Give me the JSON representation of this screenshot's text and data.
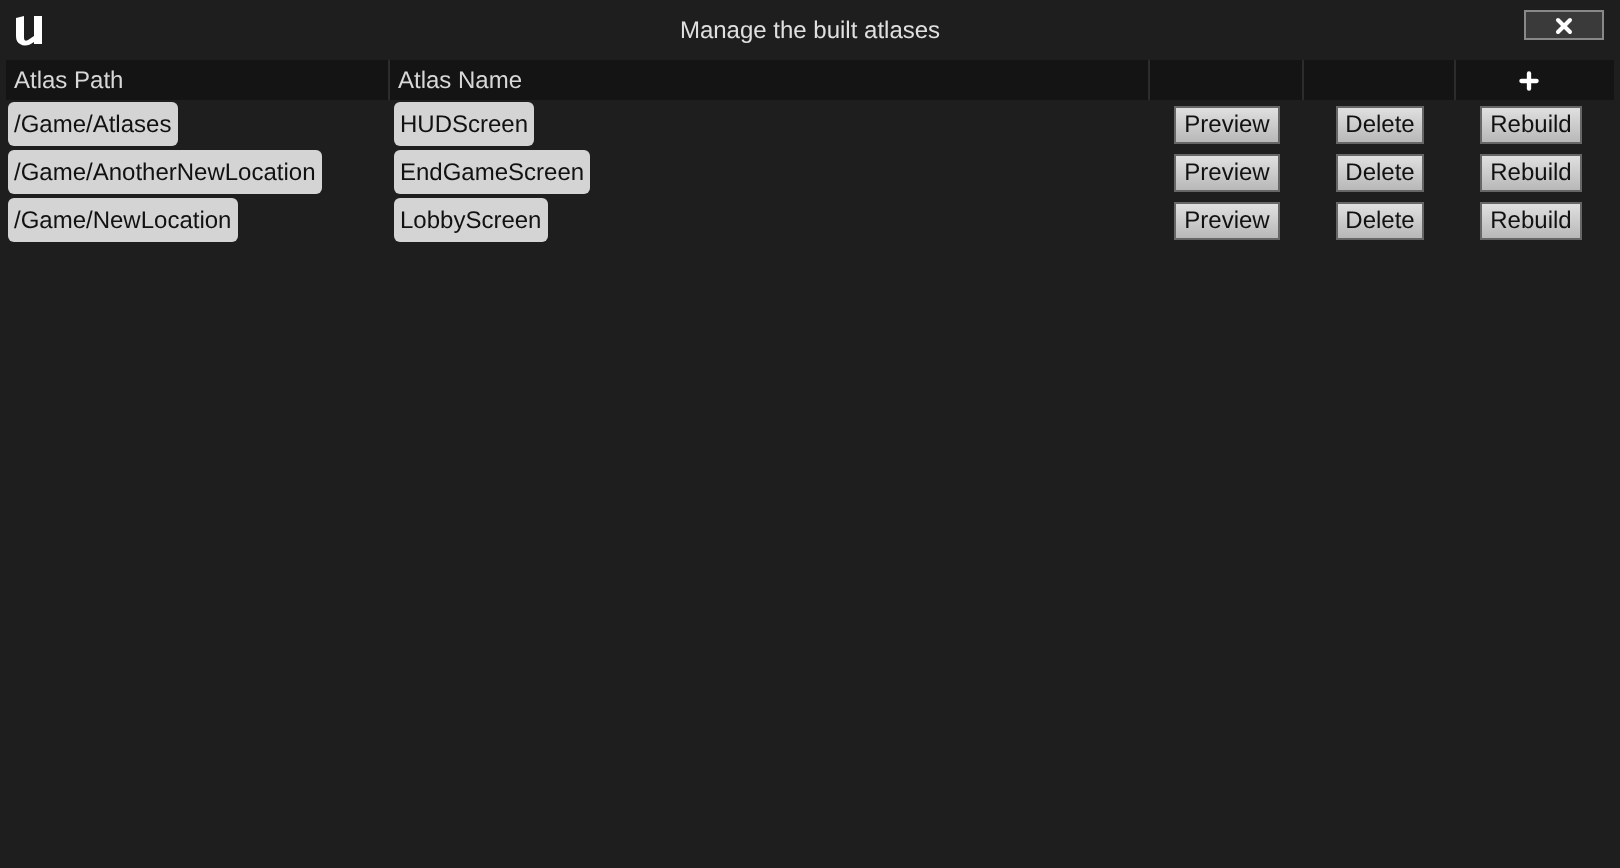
{
  "window": {
    "title": "Manage the built atlases"
  },
  "table": {
    "columns": [
      "Atlas Path",
      "Atlas Name"
    ],
    "rows": [
      {
        "path": "/Game/Atlases",
        "name": "HUDScreen",
        "actions": [
          "Preview",
          "Delete",
          "Rebuild"
        ]
      },
      {
        "path": "/Game/AnotherNewLocation",
        "name": "EndGameScreen",
        "actions": [
          "Preview",
          "Delete",
          "Rebuild"
        ]
      },
      {
        "path": "/Game/NewLocation",
        "name": "LobbyScreen",
        "actions": [
          "Preview",
          "Delete",
          "Rebuild"
        ]
      }
    ]
  }
}
